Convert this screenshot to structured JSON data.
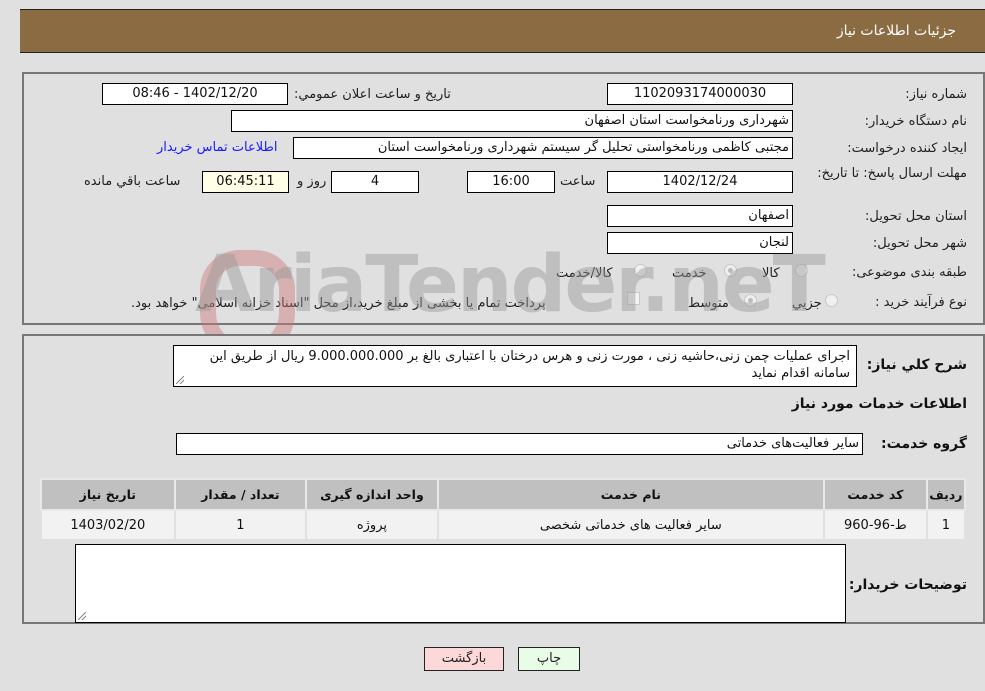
{
  "header": {
    "title": "جزئیات اطلاعات نیاز"
  },
  "fields": {
    "need_number": {
      "label": "شماره نیاز:",
      "value": "1102093174000030"
    },
    "announce_datetime": {
      "label": "تاریخ و ساعت اعلان عمومي:",
      "value": "1402/12/20 - 08:46"
    },
    "buyer_org": {
      "label": "نام دستگاه خریدار:",
      "value": "شهرداری ورنامخواست استان اصفهان"
    },
    "requester": {
      "label": "ایجاد کننده درخواست:",
      "value": "مجتبی کاظمی ورنامخواستی تحلیل گر سیستم  شهرداری ورنامخواست استان"
    },
    "buyer_contact_link": "اطلاعات تماس خریدار",
    "deadline": {
      "label": "مهلت ارسال پاسخ: تا تاریخ:",
      "date": "1402/12/24",
      "time_label": "ساعت",
      "time": "16:00",
      "days": "4",
      "days_label": "روز و",
      "remaining": "06:45:11",
      "remaining_label": "ساعت باقي مانده"
    },
    "delivery_province": {
      "label": "استان محل تحویل:",
      "value": "اصفهان"
    },
    "delivery_city": {
      "label": "شهر محل تحویل:",
      "value": "لنجان"
    },
    "category": {
      "label": "طبقه بندی موضوعی:",
      "options": [
        "کالا",
        "خدمت",
        "کالا/خدمت"
      ],
      "selected": "خدمت"
    },
    "purchase_type": {
      "label": "نوع فرآیند خرید :",
      "options": [
        "جزيي",
        "متوسط"
      ],
      "selected": "متوسط",
      "treasury_note": "پرداخت تمام یا بخشی از مبلغ خرید،از محل \"اسناد خزانه اسلامی\" خواهد بود."
    }
  },
  "description": {
    "label": "شرح کلي نیاز:",
    "value": "اجرای عملیات چمن زنی،حاشیه زنی ، مورت زنی و هرس درختان با اعتباری بالغ بر 9.000.000.000 ریال از طریق این سامانه اقدام نماید"
  },
  "services_section": {
    "title": "اطلاعات خدمات مورد نیاز",
    "group_label": "گروه خدمت:",
    "group_value": "سایر فعالیت‌های خدماتی"
  },
  "table": {
    "headers": [
      "ردیف",
      "کد خدمت",
      "نام خدمت",
      "واحد اندازه گیری",
      "تعداد / مقدار",
      "تاریخ نیاز"
    ],
    "rows": [
      [
        "1",
        "ط-96-960",
        "سایر فعالیت های خدماتی شخصی",
        "پروژه",
        "1",
        "1403/02/20"
      ]
    ]
  },
  "buyer_notes": {
    "label": "توضیحات خریدار:",
    "value": ""
  },
  "buttons": {
    "print": "چاپ",
    "back": "بازگشت"
  },
  "watermark": "AriaTender.neT"
}
